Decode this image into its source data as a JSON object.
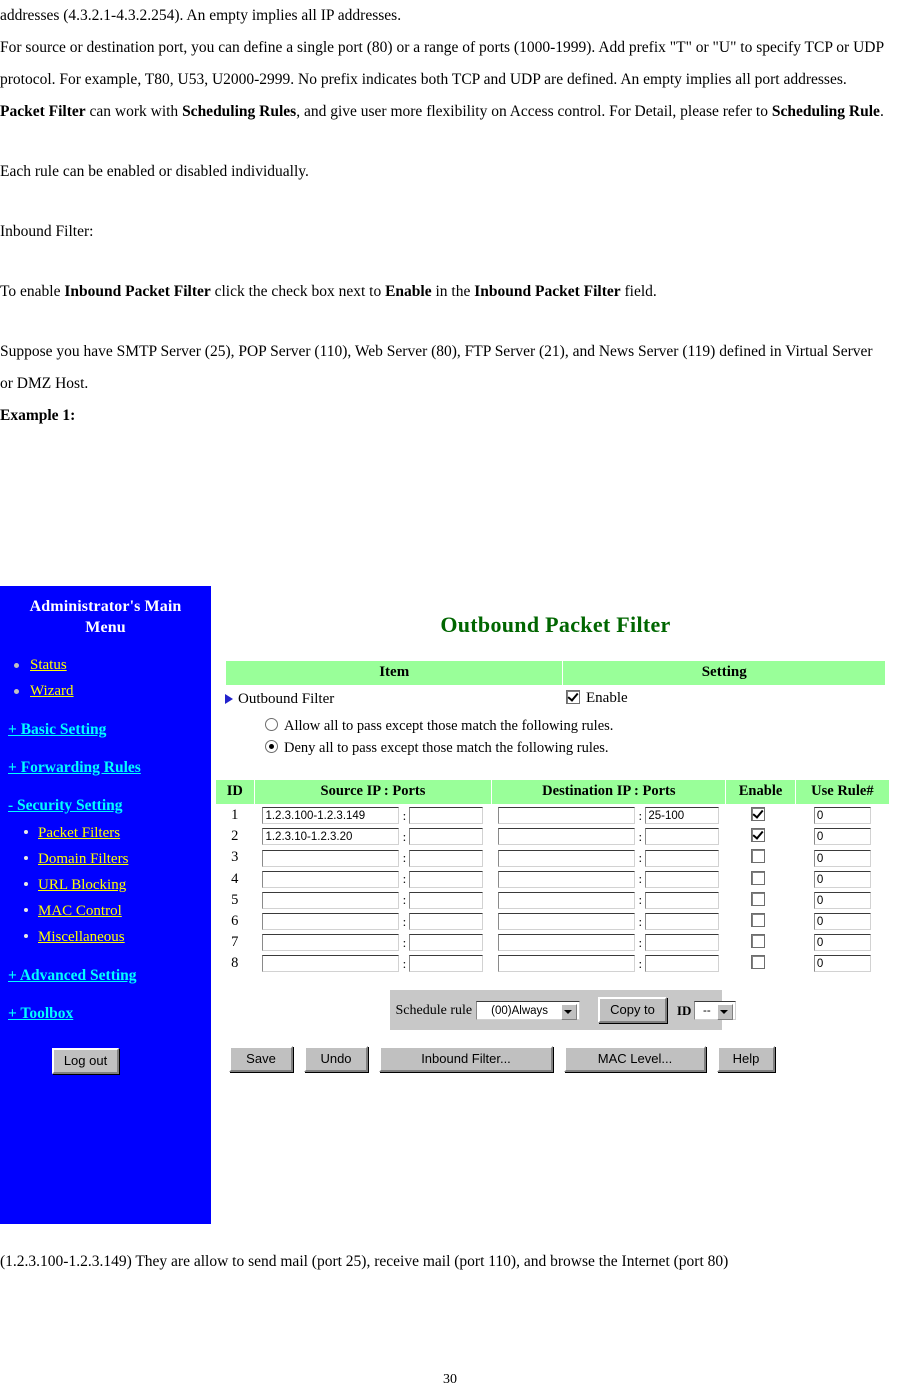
{
  "document": {
    "paragraphs_top": [
      "addresses (4.3.2.1-4.3.2.254). An empty implies all IP addresses.",
      "For source or destination port, you can define a single port (80) or a range of ports (1000-1999). Add prefix \"T\" or \"U\" to specify TCP or UDP protocol. For example, T80, U53, U2000-2999. No prefix indicates both TCP and UDP are defined. An empty implies all port addresses.",
      "Each rule can be enabled or disabled individually.",
      "Inbound Filter:",
      "Suppose you have SMTP Server (25), POP Server (110), Web Server (80), FTP Server (21), and News Server (119) defined in Virtual Server or DMZ Host."
    ],
    "para2_bold_a": "Packet Filter",
    "para2_tail_a": " can work with ",
    "para2_bold_b": "Scheduling Rules",
    "para2_tail_b": ", and give user more flexibility on Access control. For Detail, please refer to ",
    "para2_bold_c": "Scheduling Rule",
    "para2_tail_c": ".",
    "inbound_line_pre": "To enable ",
    "inbound_bold_a": "Inbound Packet Filter",
    "inbound_mid_a": " click the check box next to ",
    "inbound_bold_b": "Enable",
    "inbound_mid_b": " in the ",
    "inbound_bold_c": "Inbound Packet Filter",
    "inbound_tail": " field.",
    "example_label": "Example 1:",
    "trailing_paragraph": "(1.2.3.100-1.2.3.149) They are allow to send mail (port 25), receive mail (port 110), and browse the Internet (port 80)",
    "page_number": "30"
  },
  "router_ui": {
    "sidebar": {
      "title": "Administrator's Main Menu",
      "top_items": [
        {
          "label": "Status"
        },
        {
          "label": "Wizard"
        }
      ],
      "sections": [
        {
          "label": "+ Basic Setting",
          "expanded": false,
          "children": []
        },
        {
          "label": "+ Forwarding Rules",
          "expanded": false,
          "children": []
        },
        {
          "label": "- Security Setting",
          "expanded": true,
          "children": [
            {
              "label": "Packet Filters"
            },
            {
              "label": "Domain Filters"
            },
            {
              "label": "URL Blocking"
            },
            {
              "label": "MAC Control"
            },
            {
              "label": "Miscellaneous"
            }
          ]
        },
        {
          "label": "+ Advanced Setting",
          "expanded": false,
          "children": []
        },
        {
          "label": "+ Toolbox",
          "expanded": false,
          "children": []
        }
      ],
      "logout_label": "Log out"
    },
    "main": {
      "title": "Outbound Packet Filter",
      "item_header": "Item",
      "setting_header": "Setting",
      "filter_row_label": "Outbound Filter",
      "enable_label": "Enable",
      "enable_checked": true,
      "policy_options": [
        {
          "label": "Allow all to pass except those match the following rules.",
          "selected": false
        },
        {
          "label": "Deny all to pass except those match the following rules.",
          "selected": true
        }
      ],
      "rules_headers": [
        "ID",
        "Source IP : Ports",
        "Destination IP : Ports",
        "Enable",
        "Use Rule#"
      ],
      "rules": [
        {
          "id": "1",
          "src_ip": "1.2.3.100-1.2.3.149",
          "src_port": "",
          "dst_ip": "",
          "dst_port": "25-100",
          "enabled": true,
          "use_rule": "0"
        },
        {
          "id": "2",
          "src_ip": "1.2.3.10-1.2.3.20",
          "src_port": "",
          "dst_ip": "",
          "dst_port": "",
          "enabled": true,
          "use_rule": "0"
        },
        {
          "id": "3",
          "src_ip": "",
          "src_port": "",
          "dst_ip": "",
          "dst_port": "",
          "enabled": false,
          "use_rule": "0"
        },
        {
          "id": "4",
          "src_ip": "",
          "src_port": "",
          "dst_ip": "",
          "dst_port": "",
          "enabled": false,
          "use_rule": "0"
        },
        {
          "id": "5",
          "src_ip": "",
          "src_port": "",
          "dst_ip": "",
          "dst_port": "",
          "enabled": false,
          "use_rule": "0"
        },
        {
          "id": "6",
          "src_ip": "",
          "src_port": "",
          "dst_ip": "",
          "dst_port": "",
          "enabled": false,
          "use_rule": "0"
        },
        {
          "id": "7",
          "src_ip": "",
          "src_port": "",
          "dst_ip": "",
          "dst_port": "",
          "enabled": false,
          "use_rule": "0"
        },
        {
          "id": "8",
          "src_ip": "",
          "src_port": "",
          "dst_ip": "",
          "dst_port": "",
          "enabled": false,
          "use_rule": "0"
        }
      ],
      "schedule": {
        "label": "Schedule rule",
        "selected_rule": "(00)Always",
        "copy_to_label": "Copy to",
        "id_label": "ID",
        "selected_id": "--"
      },
      "buttons": {
        "save": "Save",
        "undo": "Undo",
        "inbound_filter": "Inbound Filter...",
        "mac_level": "MAC Level...",
        "help": "Help"
      }
    }
  },
  "colors": {
    "sidebar_bg": "#0000FF",
    "sidebar_link": "#FFFF00",
    "sidebar_section_link": "#00FFFF",
    "table_header_green": "#99FF99",
    "panel_title_green": "#006600",
    "bullet_triangle": "#2222CC"
  }
}
